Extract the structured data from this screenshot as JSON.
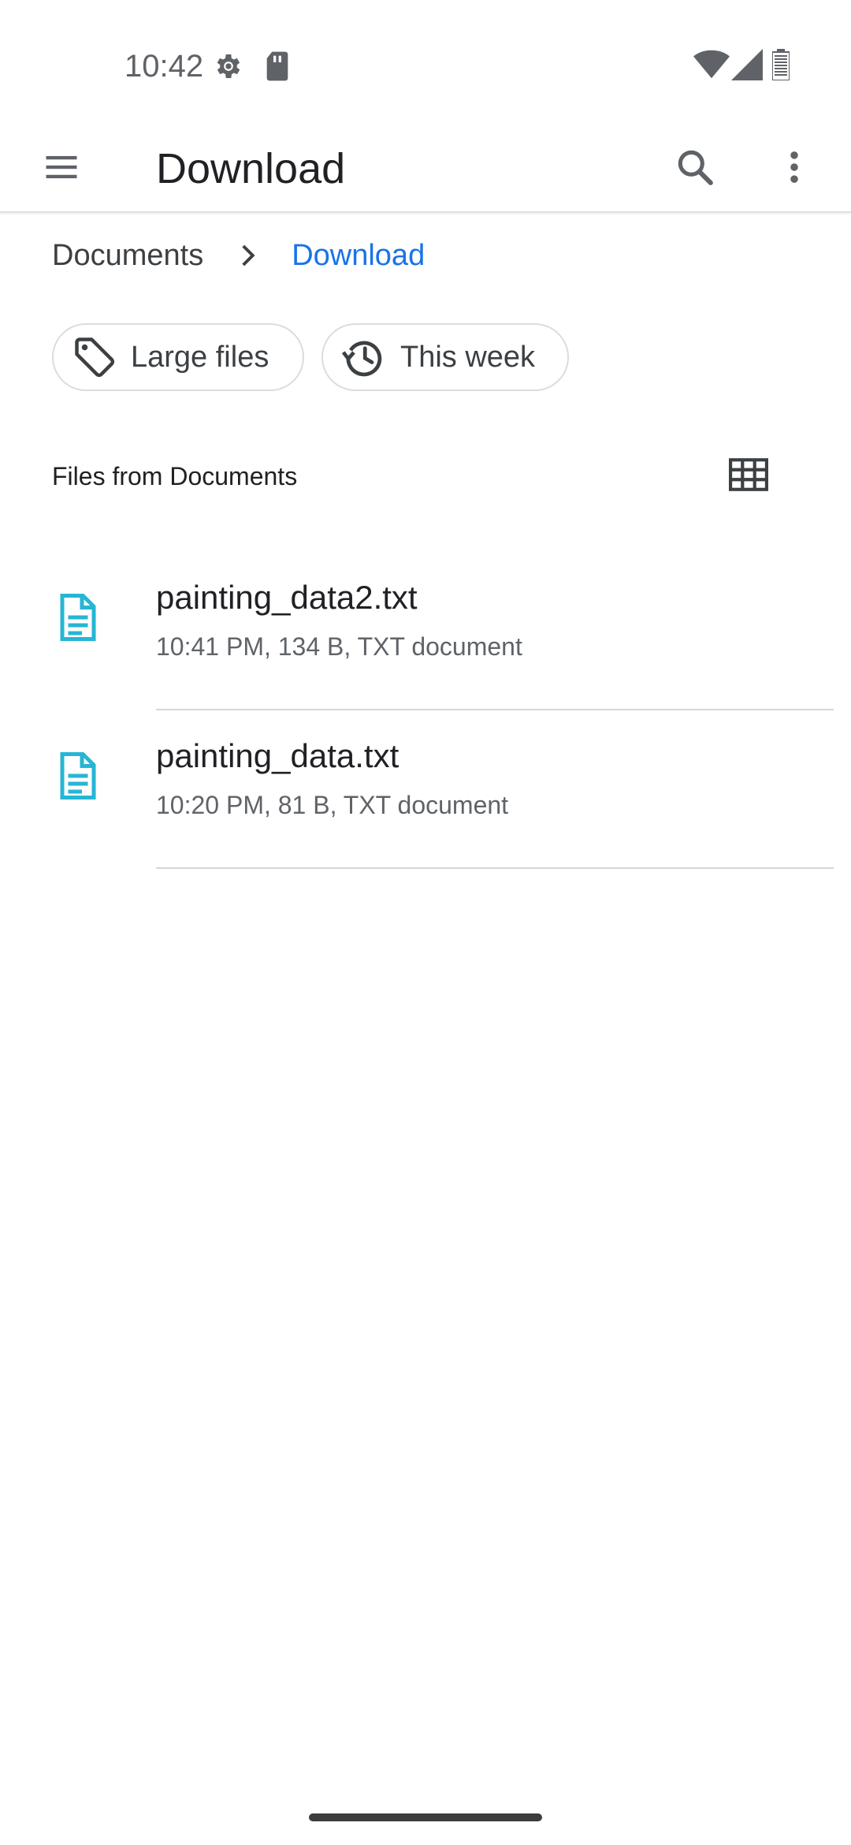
{
  "status_bar": {
    "time": "10:42",
    "icons": [
      "gear-icon",
      "sd-card-icon",
      "wifi-icon",
      "cell-signal-icon",
      "battery-icon"
    ]
  },
  "app_bar": {
    "title": "Download",
    "menu_icon": "menu-icon",
    "search_icon": "search-icon",
    "overflow_icon": "more-vert-icon"
  },
  "breadcrumb": {
    "items": [
      {
        "label": "Documents"
      },
      {
        "label": "Download"
      }
    ]
  },
  "chips": [
    {
      "label": "Large files",
      "icon": "tag-icon"
    },
    {
      "label": "This week",
      "icon": "history-icon"
    }
  ],
  "section": {
    "title": "Files from Documents",
    "view_toggle_icon": "grid-view-icon"
  },
  "files": [
    {
      "name": "painting_data2.txt",
      "meta": "10:41 PM, 134 B, TXT document",
      "icon": "text-file-icon"
    },
    {
      "name": "painting_data.txt",
      "meta": "10:20 PM, 81 B, TXT document",
      "icon": "text-file-icon"
    }
  ],
  "colors": {
    "accent": "#1a73e8",
    "file_icon": "#26b6d4",
    "text_primary": "#202124",
    "text_secondary": "#5f6368"
  }
}
